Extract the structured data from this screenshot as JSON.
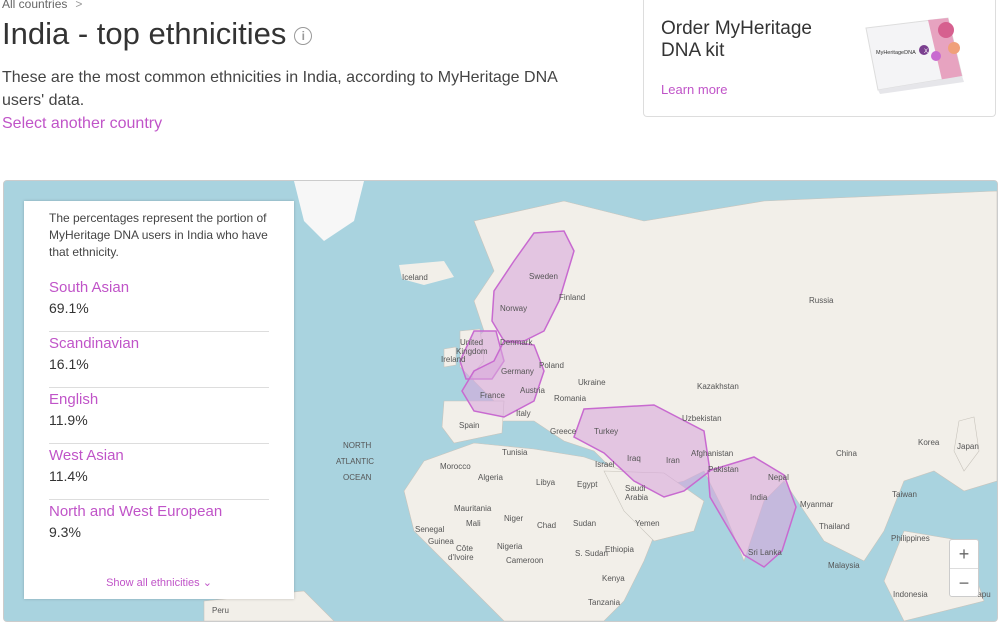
{
  "breadcrumb": {
    "text": "All countries",
    "separator": ">"
  },
  "title": "India - top ethnicities",
  "info_icon": "i",
  "description": "These are the most common ethnicities in India, according to MyHeritage DNA users' data.",
  "select_link": "Select another country",
  "promo": {
    "heading": "Order MyHeritage DNA kit",
    "link": "Learn more",
    "kit_label": "MyHeritageDNA"
  },
  "panel": {
    "note": "The percentages represent the portion of MyHeritage DNA users in India who have that ethnicity.",
    "ethnicities": [
      {
        "name": "South Asian",
        "pct": "69.1%"
      },
      {
        "name": "Scandinavian",
        "pct": "16.1%"
      },
      {
        "name": "English",
        "pct": "11.9%"
      },
      {
        "name": "West Asian",
        "pct": "11.4%"
      },
      {
        "name": "North and West European",
        "pct": "9.3%"
      }
    ],
    "show_all": "Show all ethnicities"
  },
  "map_labels": {
    "iceland": "Iceland",
    "sweden": "Sweden",
    "finland": "Finland",
    "norway": "Norway",
    "russia": "Russia",
    "uk1": "United",
    "uk2": "Kingdom",
    "ireland": "Ireland",
    "denmark": "Denmark",
    "germany": "Germany",
    "poland": "Poland",
    "ukraine": "Ukraine",
    "austria": "Austria",
    "france": "France",
    "romania": "Romania",
    "kazakhstan": "Kazakhstan",
    "uzbekistan": "Uzbekistan",
    "italy": "Italy",
    "spain": "Spain",
    "greece": "Greece",
    "turkey": "Turkey",
    "north": "NORTH",
    "atlantic": "ATLANTIC",
    "ocean": "OCEAN",
    "tunisia": "Tunisia",
    "morocco": "Morocco",
    "algeria": "Algeria",
    "libya": "Libya",
    "egypt": "Egypt",
    "israel": "Israel",
    "iraq": "Iraq",
    "iran": "Iran",
    "afghanistan": "Afghanistan",
    "pakistan": "Pakistan",
    "nepal": "Nepal",
    "china": "China",
    "korea": "Korea",
    "japan": "Japan",
    "india": "India",
    "saudi1": "Saudi",
    "saudi2": "Arabia",
    "taiwan": "Taiwan",
    "myanmar": "Myanmar",
    "thailand": "Thailand",
    "mauritania": "Mauritania",
    "mali": "Mali",
    "niger": "Niger",
    "chad": "Chad",
    "sudan": "Sudan",
    "yemen": "Yemen",
    "senegal": "Senegal",
    "guinea": "Guinea",
    "cote1": "Côte",
    "cote2": "d'Ivoire",
    "nigeria": "Nigeria",
    "ssudan": "S. Sudan",
    "ethiopia": "Ethiopia",
    "cameroon": "Cameroon",
    "kenya": "Kenya",
    "srilanka": "Sri Lanka",
    "philippines": "Philippines",
    "malaysia": "Malaysia",
    "tanzania": "Tanzania",
    "peru": "Peru",
    "indonesia": "Indonesia",
    "papua": "Papu"
  },
  "zoom": {
    "in": "+",
    "out": "−"
  },
  "colors": {
    "accent": "#c054c8",
    "region_fill": "#d9a8dc",
    "region_stroke": "#c86ad0",
    "water": "#a9d3df",
    "land": "#f2efe9"
  }
}
